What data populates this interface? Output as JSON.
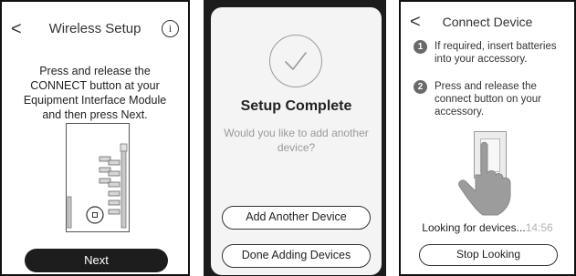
{
  "screen1": {
    "back_glyph": "<",
    "title": "Wireless Setup",
    "info_glyph": "i",
    "instructions": "Press and release the CONNECT button at your Equipment Interface Module and then press Next.",
    "next_label": "Next",
    "icons": {
      "back": "chevron-left-icon",
      "info": "info-icon",
      "module": "equipment-interface-module-diagram"
    }
  },
  "screen2": {
    "title": "Setup Complete",
    "question": "Would you like to add another device?",
    "add_label": "Add Another Device",
    "done_label": "Done Adding Devices",
    "icons": {
      "check": "checkmark-circle-icon"
    }
  },
  "screen3": {
    "back_glyph": "<",
    "title": "Connect Device",
    "steps": [
      {
        "num": "1",
        "text": "If required, insert batteries into your accessory."
      },
      {
        "num": "2",
        "text": "Press and release the connect button on your accessory."
      }
    ],
    "looking_text": "Looking for devices...",
    "timer": "14:56",
    "stop_label": "Stop Looking",
    "icons": {
      "back": "chevron-left-icon",
      "device": "accessory-device-icon",
      "hand": "pressing-hand-icon"
    }
  },
  "colors": {
    "dark_frame": "#1c1c1c",
    "button_dark": "#1d1d1d",
    "step_badge": "#6a6a6a",
    "muted_text": "#9a9a9a"
  }
}
